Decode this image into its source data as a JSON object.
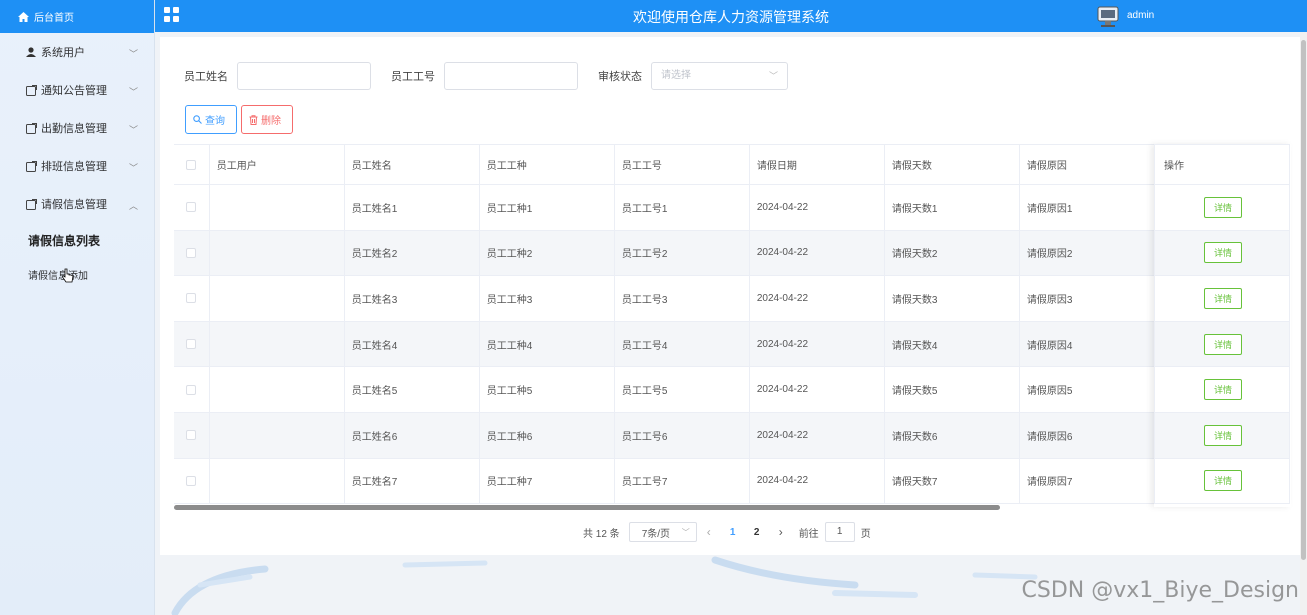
{
  "app": {
    "title": "欢迎使用仓库人力资源管理系统",
    "username": "admin"
  },
  "sidebar": {
    "home_label": "后台首页",
    "menus": [
      {
        "label": "系统用户",
        "icon": "user-icon"
      },
      {
        "label": "通知公告管理",
        "icon": "doc-icon"
      },
      {
        "label": "出勤信息管理",
        "icon": "doc-icon"
      },
      {
        "label": "排班信息管理",
        "icon": "doc-icon"
      },
      {
        "label": "请假信息管理",
        "icon": "doc-icon",
        "expanded": true
      }
    ],
    "sub_items": [
      {
        "label": "请假信息列表",
        "active": true
      },
      {
        "label": "请假信息添加",
        "active": false
      }
    ]
  },
  "search": {
    "name_label": "员工姓名",
    "id_label": "员工工号",
    "status_label": "审核状态",
    "status_placeholder": "请选择",
    "query_button": "查询",
    "delete_button": "删除"
  },
  "table": {
    "columns": [
      "员工用户",
      "员工姓名",
      "员工工种",
      "员工工号",
      "请假日期",
      "请假天数",
      "请假原因",
      "操作"
    ],
    "detail_label": "详情",
    "rows": [
      [
        "",
        "员工姓名1",
        "员工工种1",
        "员工工号1",
        "2024-04-22",
        "请假天数1",
        "请假原因1"
      ],
      [
        "",
        "员工姓名2",
        "员工工种2",
        "员工工号2",
        "2024-04-22",
        "请假天数2",
        "请假原因2"
      ],
      [
        "",
        "员工姓名3",
        "员工工种3",
        "员工工号3",
        "2024-04-22",
        "请假天数3",
        "请假原因3"
      ],
      [
        "",
        "员工姓名4",
        "员工工种4",
        "员工工号4",
        "2024-04-22",
        "请假天数4",
        "请假原因4"
      ],
      [
        "",
        "员工姓名5",
        "员工工种5",
        "员工工号5",
        "2024-04-22",
        "请假天数5",
        "请假原因5"
      ],
      [
        "",
        "员工姓名6",
        "员工工种6",
        "员工工号6",
        "2024-04-22",
        "请假天数6",
        "请假原因6"
      ],
      [
        "",
        "员工姓名7",
        "员工工种7",
        "员工工号7",
        "2024-04-22",
        "请假天数7",
        "请假原因7"
      ]
    ]
  },
  "pagination": {
    "total": "共 12 条",
    "page_size": "7条/页",
    "pages": [
      "1",
      "2"
    ],
    "current": "1",
    "goto_prefix": "前往",
    "goto_value": "1",
    "goto_suffix": "页"
  },
  "watermark": "CSDN @vx1_Biye_Design",
  "colors": {
    "primary": "#1e90f5",
    "link": "#409eff",
    "danger": "#f56c6c",
    "success": "#67c23a"
  }
}
